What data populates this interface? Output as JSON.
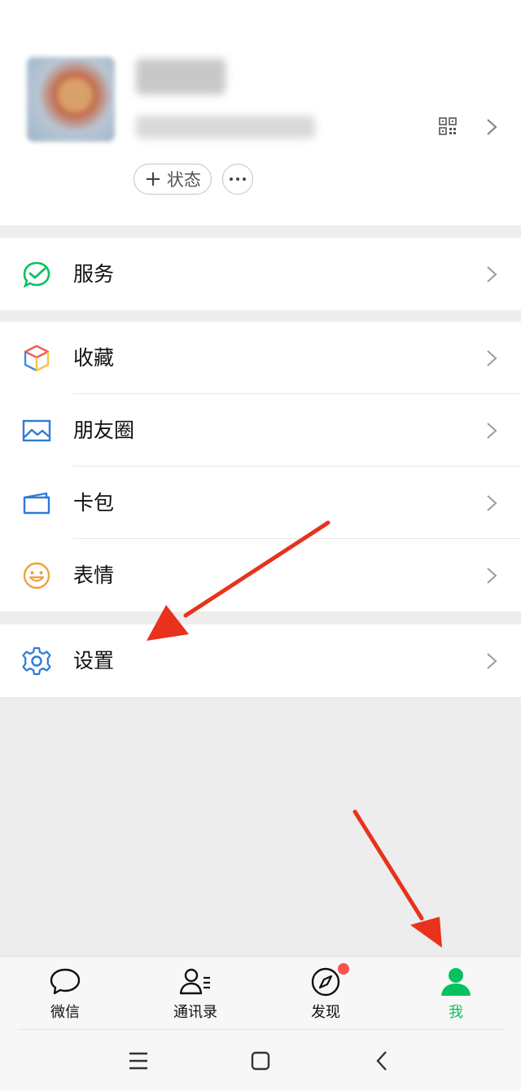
{
  "profile": {
    "status_label": "状态",
    "status_plus": "+"
  },
  "menu": {
    "services": "服务",
    "favorites": "收藏",
    "moments": "朋友圈",
    "cards": "卡包",
    "stickers": "表情",
    "settings": "设置"
  },
  "tabs": [
    {
      "label": "微信",
      "icon": "chat-bubble-icon"
    },
    {
      "label": "通讯录",
      "icon": "contacts-icon"
    },
    {
      "label": "发现",
      "icon": "compass-icon"
    },
    {
      "label": "我",
      "icon": "person-icon"
    }
  ],
  "colors": {
    "accent": "#07c160",
    "badge": "#fa5151",
    "annotation": "#e8321c"
  }
}
